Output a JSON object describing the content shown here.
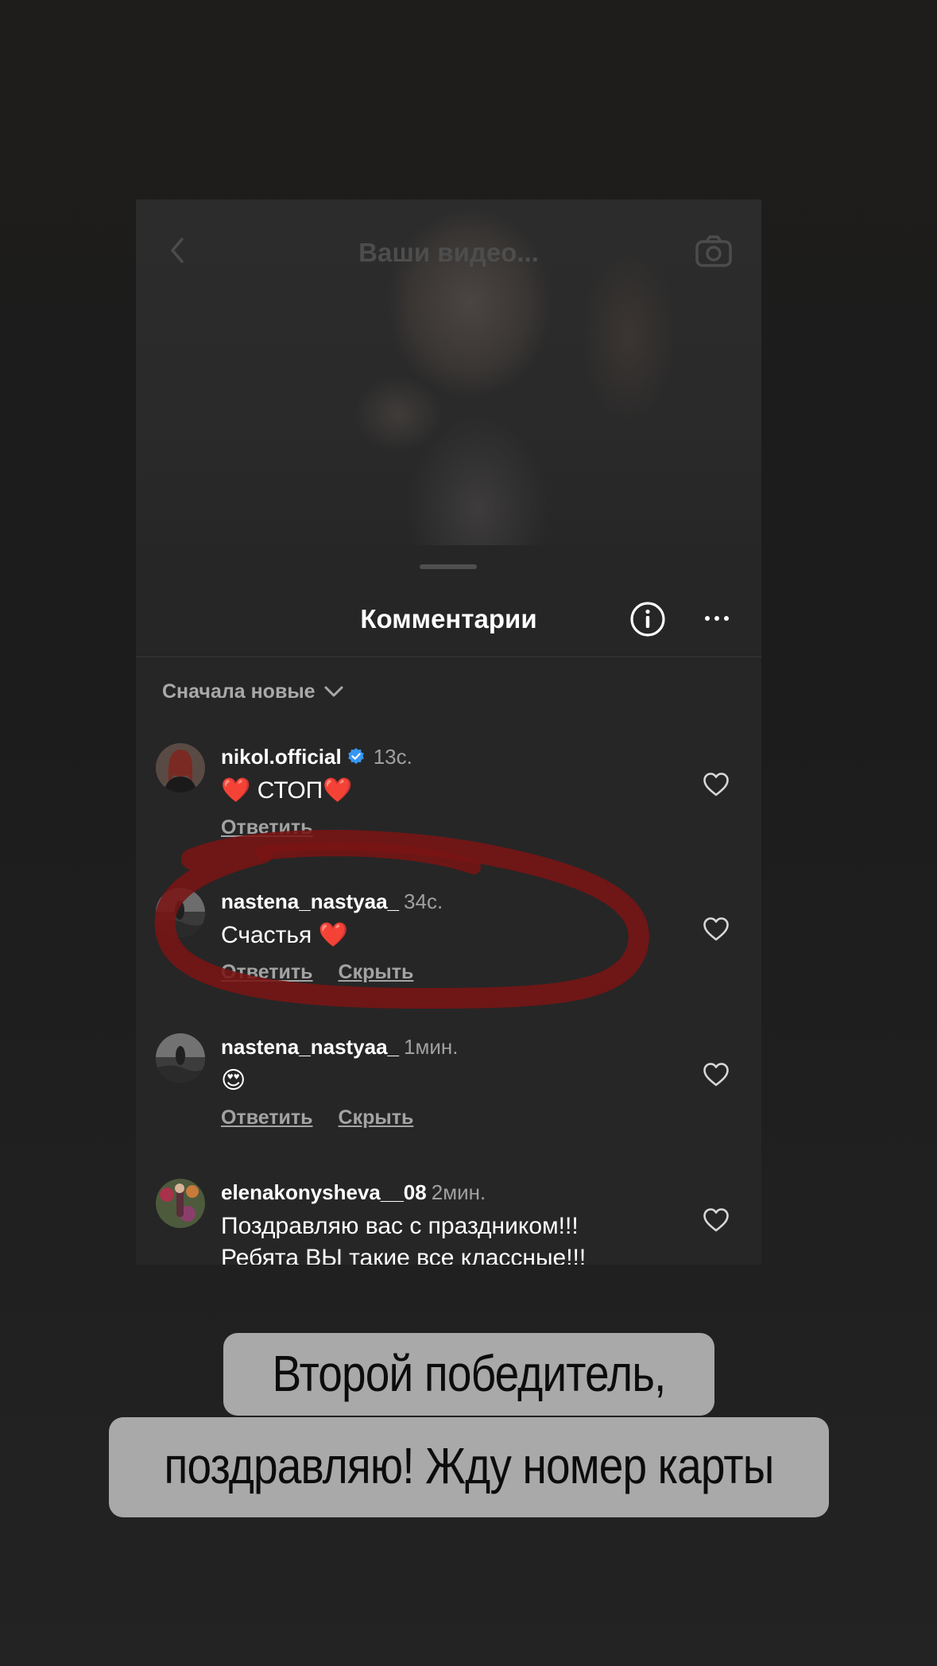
{
  "photo": {
    "title": "Ваши видео..."
  },
  "sheet": {
    "title": "Комментарии"
  },
  "sort": {
    "label": "Сначала новые"
  },
  "comments": [
    {
      "username": "nikol.official",
      "verified": true,
      "time": "13с.",
      "text": "❤️ СТОП❤️",
      "actions": [
        "Ответить"
      ]
    },
    {
      "username": "nastena_nastyaa_",
      "verified": false,
      "time": "34с.",
      "text": "Счастья ❤️",
      "actions": [
        "Ответить",
        "Скрыть"
      ]
    },
    {
      "username": "nastena_nastyaa_",
      "verified": false,
      "time": "1мин.",
      "text": "😍",
      "actions": [
        "Ответить",
        "Скрыть"
      ]
    },
    {
      "username": "elenakonysheva__08",
      "verified": false,
      "time": "2мин.",
      "text": "Поздравляю вас с праздником!!!",
      "text2": "Ребята ВЫ такие все классные!!!",
      "actions": []
    }
  ],
  "caption": {
    "line1": "Второй победитель,",
    "line2": "поздравляю! Жду номер карты"
  },
  "colors": {
    "accent_red": "#8b1a1a",
    "verified_blue": "#3797f0",
    "heart_red": "#e8202a"
  }
}
